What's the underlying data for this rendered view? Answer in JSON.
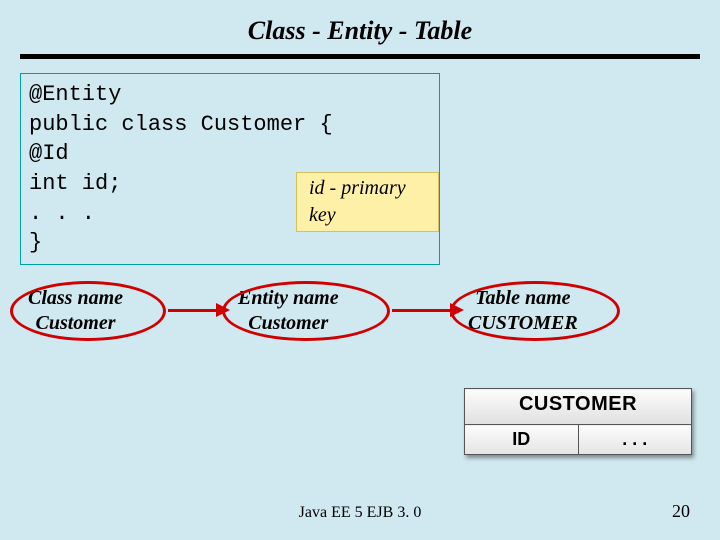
{
  "title": "Class - Entity - Table",
  "code": {
    "line1": "@Entity",
    "line2": "public class Customer {",
    "line3": "@Id",
    "line4": "int id;",
    "line5": ". . .",
    "line6": "}"
  },
  "annotation": "id - primary key",
  "mapping": {
    "class": {
      "heading": "Class name",
      "value": "Customer"
    },
    "entity": {
      "heading": "Entity  name",
      "value": "Customer"
    },
    "table": {
      "heading": "Table name",
      "value": "CUSTOMER"
    }
  },
  "db_table": {
    "title": "CUSTOMER",
    "col1": "ID",
    "col2": ". . ."
  },
  "footer": "Java EE 5 EJB 3. 0",
  "page": "20"
}
